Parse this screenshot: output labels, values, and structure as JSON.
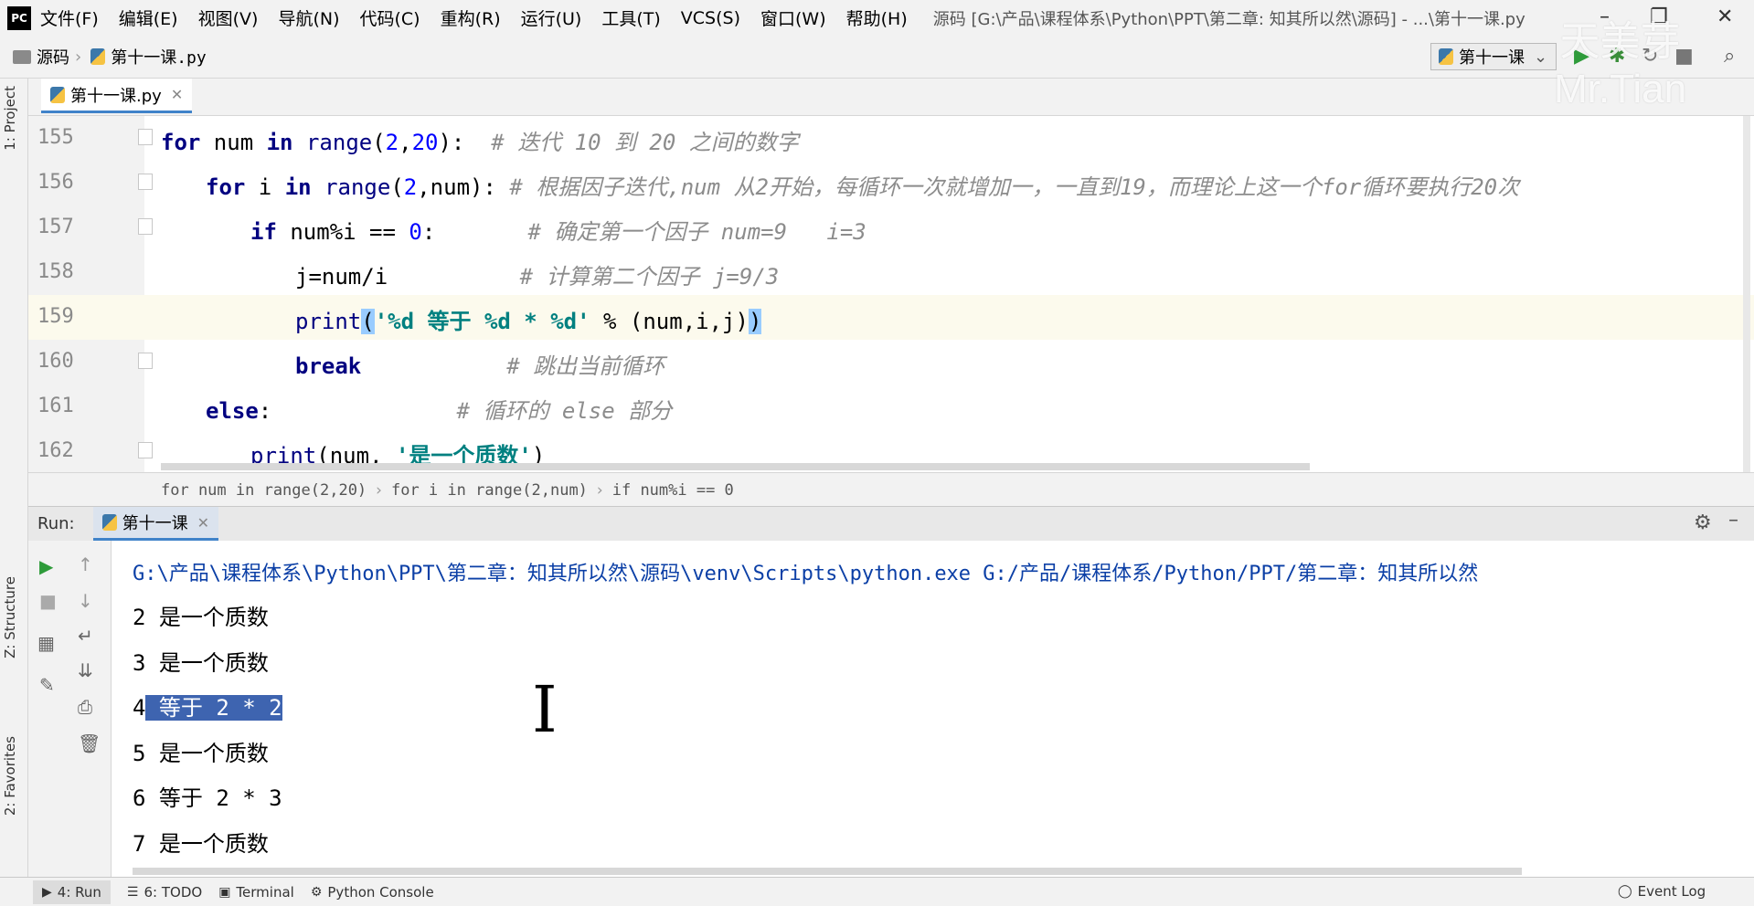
{
  "app": {
    "logo": "PC",
    "window_title": "源码 [G:\\产品\\课程体系\\Python\\PPT\\第二章: 知其所以然\\源码] - ...\\第十一课.py",
    "watermark_line1": "天美芽",
    "watermark_line2": "Mr.Tian"
  },
  "menu": [
    "文件(F)",
    "编辑(E)",
    "视图(V)",
    "导航(N)",
    "代码(C)",
    "重构(R)",
    "运行(U)",
    "工具(T)",
    "VCS(S)",
    "窗口(W)",
    "帮助(H)"
  ],
  "navbar": {
    "project": "源码",
    "file": "第十一课.py",
    "run_config": "第十一课"
  },
  "side_tabs": {
    "project": "1: Project",
    "structure": "Z: Structure",
    "favorites": "2: Favorites"
  },
  "editor": {
    "tab_label": "第十一课.py",
    "lines": [
      {
        "num": "155"
      },
      {
        "num": "156"
      },
      {
        "num": "157"
      },
      {
        "num": "158"
      },
      {
        "num": "159"
      },
      {
        "num": "160"
      },
      {
        "num": "161"
      },
      {
        "num": "162"
      }
    ],
    "code": {
      "l155_kw1": "for",
      "l155_a": " num ",
      "l155_kw2": "in",
      "l155_fn": " range",
      "l155_b": "(",
      "l155_n1": "2",
      "l155_c": ",",
      "l155_n2": "20",
      "l155_d": "):  ",
      "l155_cmt": "# 迭代 10 到 20 之间的数字",
      "l156_kw1": "for",
      "l156_a": " i ",
      "l156_kw2": "in",
      "l156_fn": " range",
      "l156_b": "(",
      "l156_n1": "2",
      "l156_c": ",num): ",
      "l156_cmt": "# 根据因子迭代,num 从2开始，每循环一次就增加一，一直到19，而理论上这一个for循环要执行20次",
      "l157_kw": "if",
      "l157_a": " num%i == ",
      "l157_n": "0",
      "l157_b": ":       ",
      "l157_cmt": "# 确定第一个因子 num=9   i=3",
      "l158_a": "j=num/i          ",
      "l158_cmt": "# 计算第二个因子 j=9/3",
      "l159_fn": "print",
      "l159_open": "(",
      "l159_str": "'%d 等于 %d * %d'",
      "l159_a": " % (num,i,j)",
      "l159_close": ")",
      "l160_kw": "break",
      "l160_pad": "           ",
      "l160_cmt": "# 跳出当前循环",
      "l161_kw": "else",
      "l161_a": ":              ",
      "l161_cmt": "# 循环的 else 部分",
      "l162_fn": "print",
      "l162_a": "(num, ",
      "l162_str": "'是一个质数'",
      "l162_b": ")"
    }
  },
  "breadcrumbs": [
    "for num in range(2,20)",
    "for i in range(2,num)",
    "if num%i == 0"
  ],
  "run": {
    "label": "Run:",
    "tab": "第十一课",
    "output": [
      "G:\\产品\\课程体系\\Python\\PPT\\第二章：知其所以然\\源码\\venv\\Scripts\\python.exe G:/产品/课程体系/Python/PPT/第二章：知其所以然",
      "2 是一个质数",
      "3 是一个质数",
      "4",
      "5 是一个质数",
      "6 等于 2 * 3",
      "7 是一个质数"
    ],
    "selected_text": " 等于 2 * 2"
  },
  "bottom_tabs": {
    "run": "4: Run",
    "todo": "6: TODO",
    "terminal": "Terminal",
    "python_console": "Python Console",
    "event_log": "Event Log"
  },
  "colors": {
    "keyword": "#000080",
    "string": "#008080",
    "comment": "#8c8c8c",
    "number": "#0000ff",
    "selection": "#3e64b0",
    "accent": "#4083c9"
  }
}
